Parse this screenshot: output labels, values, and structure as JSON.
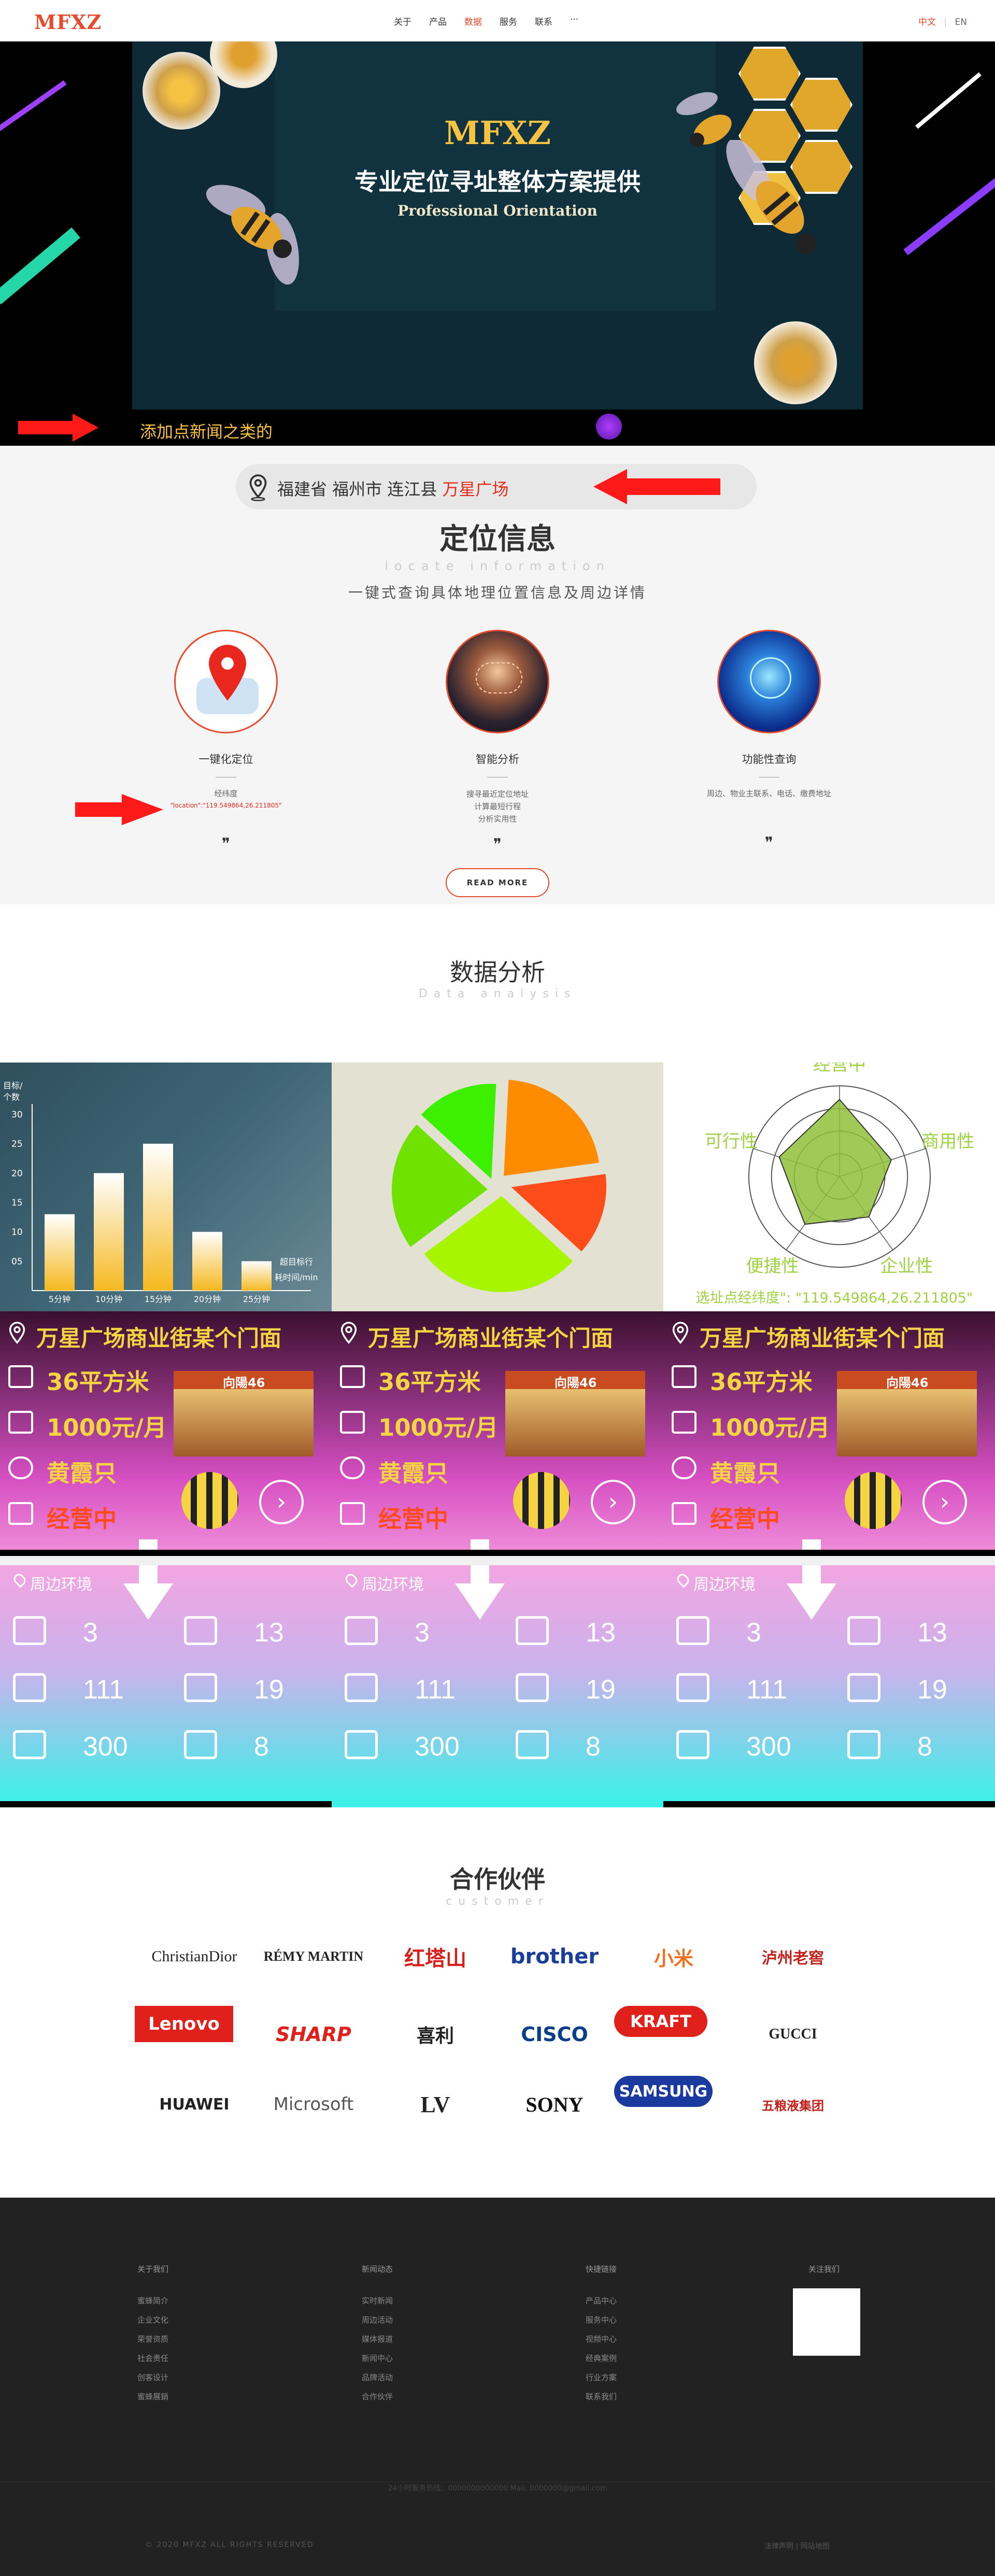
{
  "header": {
    "logo": "MFXZ",
    "nav": [
      "关于",
      "产品",
      "数据",
      "服务",
      "联系",
      "···"
    ],
    "lang_cn": "中文",
    "lang_sep": "|",
    "lang_en": "EN",
    "accent": "#e54b2c"
  },
  "hero": {
    "title": "MFXZ",
    "subtitle": "专业定位寻址整体方案提供",
    "subtitle_en": "Professional Orientation",
    "news": "添加点新闻之类的"
  },
  "locate": {
    "address_prefix": "福建省 福州市 连江县",
    "address_highlight": "万星广场",
    "title": "定位信息",
    "title_en": "locate information",
    "subtitle": "一键式查询具体地理位置信息及周边详情",
    "features": [
      {
        "title": "一键化定位",
        "lines": [
          "经纬度",
          "\"location\":\"119.549864,26.211805\""
        ],
        "icon": "map-pin-icon"
      },
      {
        "title": "智能分析",
        "lines": [
          "搜寻最近定位地址",
          "计算最短行程",
          "分析实用性"
        ],
        "icon": "network-icon"
      },
      {
        "title": "功能性查询",
        "lines": [
          "周边、物业主联系、电话、缴费地址"
        ],
        "icon": "globe-icon"
      }
    ],
    "quote_mark": "❞",
    "read_more": "READ MORE"
  },
  "data": {
    "title": "数据分析",
    "title_en": "Data analysis",
    "radar_caption": "选址点经纬度\": \"119.549864,26.211805\""
  },
  "chart_data": [
    {
      "type": "bar",
      "ylabel": "目标/个数",
      "xlabel": "耗时间/min",
      "legend": "超目标行",
      "categories": [
        "5分钟",
        "10分钟",
        "15分钟",
        "20分钟",
        "25分钟"
      ],
      "values": [
        13,
        20,
        25,
        10,
        5
      ],
      "yticks": [
        "05",
        "10",
        "15",
        "20",
        "25",
        "30"
      ],
      "ylim": [
        0,
        30
      ]
    },
    {
      "type": "pie",
      "values": [
        22,
        14,
        28,
        22,
        14
      ],
      "colors": [
        "#ff8c00",
        "#ff4c1a",
        "#a8f500",
        "#6fe200",
        "#3cf000"
      ]
    },
    {
      "type": "radar",
      "axes": [
        "经营中",
        "商用性",
        "企业性",
        "便捷性",
        "可行性"
      ],
      "values": [
        0.85,
        0.6,
        0.55,
        0.65,
        0.7
      ],
      "fill": "#8fbf3a"
    }
  ],
  "shops": [
    {
      "title": "万星广场商业街某个门面",
      "area": "36平方米",
      "rent": "1000元/月",
      "owner": "黄霞只",
      "status": "经营中",
      "sign": "向陽46"
    },
    {
      "title": "万星广场商业街某个门面",
      "area": "36平方米",
      "rent": "1000元/月",
      "owner": "黄霞只",
      "status": "经营中",
      "sign": "向陽46"
    },
    {
      "title": "万星广场商业街某个门面",
      "area": "36平方米",
      "rent": "1000元/月",
      "owner": "黄霞只",
      "status": "经营中",
      "sign": "向陽46"
    }
  ],
  "env": [
    {
      "label": "周边环境",
      "school": "3",
      "building": "13",
      "food": "111",
      "cafe": "19",
      "shop": "300",
      "car": "8"
    },
    {
      "label": "周边环境",
      "school": "3",
      "building": "13",
      "food": "111",
      "cafe": "19",
      "shop": "300",
      "car": "8"
    },
    {
      "label": "周边环境",
      "school": "3",
      "building": "13",
      "food": "111",
      "cafe": "19",
      "shop": "300",
      "car": "8"
    }
  ],
  "partners": {
    "title": "合作伙伴",
    "title_en": "customer",
    "logos": [
      "ChristianDior",
      "RÉMY MARTIN",
      "红塔山",
      "brother",
      "小米",
      "泸州老窖",
      "Lenovo",
      "SHARP",
      "喜利",
      "CISCO",
      "KRAFT",
      "GUCCI",
      "HUAWEI",
      "Microsoft",
      "LV",
      "SONY",
      "SAMSUNG",
      "五粮液集团"
    ]
  },
  "footer": {
    "cols": [
      {
        "head": "关于我们",
        "items": [
          "蜜蜂简介",
          "企业文化",
          "荣誉资质",
          "社会责任",
          "创客设计",
          "蜜蜂展銷"
        ]
      },
      {
        "head": "新闻动态",
        "items": [
          "实时新闻",
          "周边活动",
          "媒体报道",
          "新闻中心",
          "品牌活动",
          "合作伙伴"
        ]
      },
      {
        "head": "快捷链接",
        "items": [
          "产品中心",
          "服务中心",
          "视频中心",
          "经典案例",
          "行业方案",
          "联系我们"
        ]
      },
      {
        "head": "关注我们",
        "items": []
      }
    ],
    "contact": "24小时服务热线：0000000000000   Mail: 0000000@gmail.com",
    "copyright": "© 2020 MFXZ ALL RIGHTS RESERVED",
    "links": "法律声明  |  网站地图"
  }
}
